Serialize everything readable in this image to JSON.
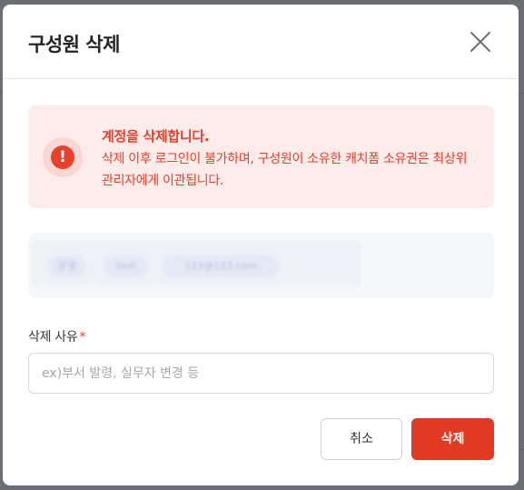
{
  "modal": {
    "title": "구성원 삭제",
    "close_icon": "close-icon"
  },
  "alert": {
    "icon": "exclamation-icon",
    "title": "계정을 삭제합니다.",
    "body": "삭제 이후 로그인이 불가하며, 구성원이 소유한 캐치폼 소유권은 최상위 관리자에게 이관됩니다."
  },
  "user_card": {
    "chips": [
      "운영",
      "test",
      "123@123.com"
    ]
  },
  "reason": {
    "label": "삭제 사유",
    "required_mark": "*",
    "value": "",
    "placeholder": "ex)부서 발령, 실무자 변경 등"
  },
  "actions": {
    "cancel_label": "취소",
    "delete_label": "삭제"
  },
  "colors": {
    "accent": "#e13a22",
    "alert_background": "#fdecea",
    "alert_text": "#e8402a"
  }
}
